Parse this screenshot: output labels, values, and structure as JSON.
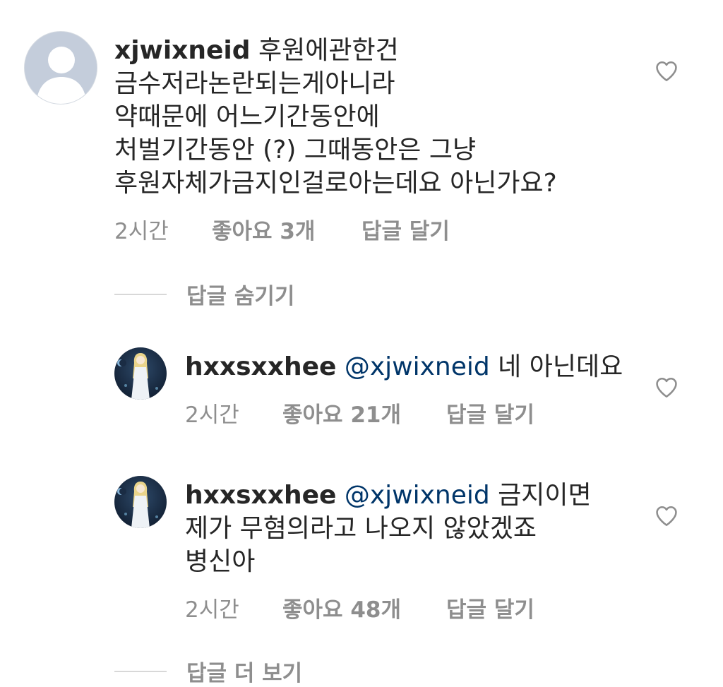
{
  "comments": [
    {
      "username": "xjwixneid",
      "text_line1": " 후원에관한건",
      "text_rest": "금수저라논란되는게아니라\n약때문에 어느기간동안에\n처벌기간동안 (?) 그때동안은 그냥\n후원자체가금지인걸로아는데요 아닌가요?",
      "time": "2시간",
      "likes": "좋아요 3개",
      "reply": "답글 달기"
    }
  ],
  "hide_replies_label": "답글 숨기기",
  "replies": [
    {
      "username": "hxxsxxhee",
      "mention": "@xjwixneid",
      "text_line1": " 네 아닌데요",
      "text_rest": "",
      "time": "2시간",
      "likes": "좋아요 21개",
      "reply": "답글 달기"
    },
    {
      "username": "hxxsxxhee",
      "mention": "@xjwixneid",
      "text_line1": " 금지이면",
      "text_rest": "제가 무혐의라고 나오지 않았겠죠\n병신아",
      "time": "2시간",
      "likes": "좋아요 48개",
      "reply": "답글 달기"
    }
  ],
  "more_replies_label": "답글 더 보기",
  "icons": {
    "like": "heart-outline-icon",
    "default_avatar": "user-silhouette-icon"
  },
  "colors": {
    "text": "#262626",
    "muted": "#8e8e8e",
    "mention": "#003569"
  }
}
